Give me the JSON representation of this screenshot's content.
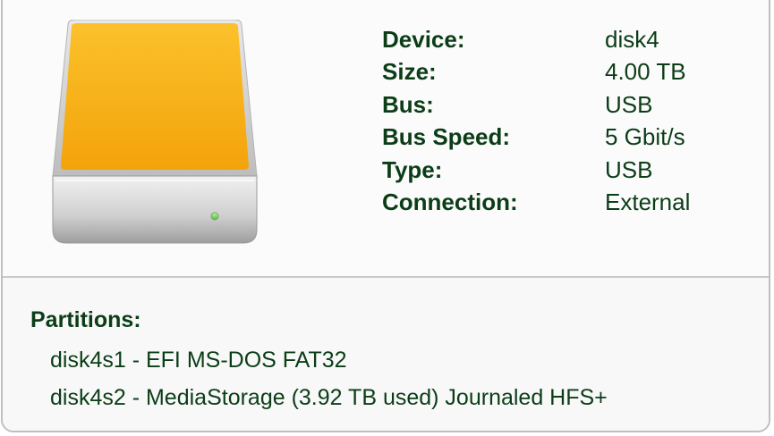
{
  "device_info": {
    "rows": [
      {
        "label": "Device:",
        "value": "disk4"
      },
      {
        "label": "Size:",
        "value": "4.00 TB"
      },
      {
        "label": "Bus:",
        "value": "USB"
      },
      {
        "label": "Bus Speed:",
        "value": "5 Gbit/s"
      },
      {
        "label": "Type:",
        "value": "USB"
      },
      {
        "label": "Connection:",
        "value": "External"
      }
    ]
  },
  "partitions": {
    "title": "Partitions:",
    "items": [
      "disk4s1 - EFI MS-DOS FAT32",
      "disk4s2 - MediaStorage (3.92 TB used) Journaled HFS+"
    ]
  },
  "icon": {
    "name": "external-drive-icon",
    "accent_color": "#f6a90f"
  }
}
